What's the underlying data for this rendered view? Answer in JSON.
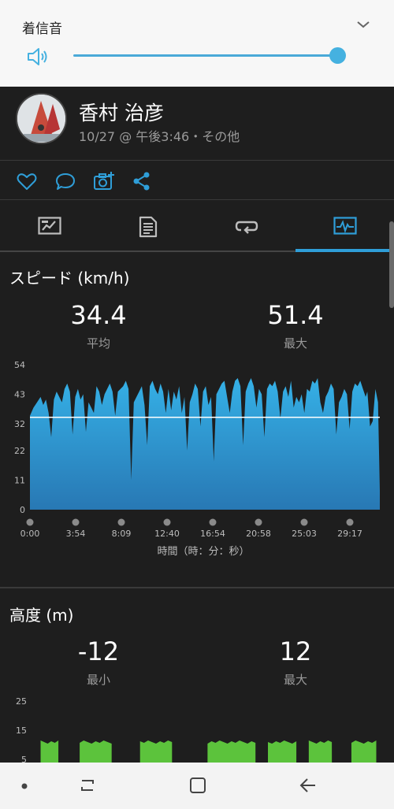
{
  "volume": {
    "label": "着信音",
    "level_percent": 100,
    "accent_color": "#45b1e0",
    "icons": [
      "speaker-icon",
      "chevron-down-icon"
    ]
  },
  "header": {
    "name": "香村 治彦",
    "meta": "10/27 @ 午後3:46・その他"
  },
  "social": {
    "icons": [
      "heart-icon",
      "comment-icon",
      "add-photo-icon",
      "share-icon"
    ],
    "color": "#2f9ed8"
  },
  "tabs": {
    "items": [
      "overview-tab-icon",
      "details-tab-icon",
      "laps-tab-icon",
      "charts-tab-icon"
    ],
    "active_index": 3
  },
  "speed": {
    "title": "スピード (km/h)",
    "avg_value": "34.4",
    "avg_label": "平均",
    "max_value": "51.4",
    "max_label": "最大"
  },
  "altitude": {
    "title": "高度 (m)",
    "min_value": "-12",
    "min_label": "最小",
    "max_value": "12",
    "max_label": "最大"
  },
  "chart_data": [
    {
      "type": "area",
      "xlabel": "時間（時：分：秒）",
      "ylabel": "",
      "x_tick_labels": [
        "0:00",
        "3:54",
        "8:09",
        "12:40",
        "16:54",
        "20:58",
        "25:03",
        "29:17"
      ],
      "y_ticks": [
        "0",
        "11",
        "22",
        "32",
        "43",
        "54"
      ],
      "ylim": [
        0,
        54
      ],
      "xlim": [
        0,
        1970
      ],
      "average_line": 34.4,
      "fill_color": "#2fa3d8",
      "x": [
        0,
        20,
        40,
        60,
        75,
        90,
        105,
        120,
        135,
        150,
        165,
        180,
        195,
        210,
        225,
        240,
        255,
        270,
        285,
        300,
        315,
        330,
        345,
        360,
        375,
        390,
        405,
        420,
        435,
        450,
        465,
        480,
        495,
        510,
        525,
        540,
        555,
        570,
        585,
        600,
        615,
        630,
        645,
        660,
        675,
        690,
        705,
        720,
        735,
        750,
        765,
        780,
        795,
        810,
        825,
        840,
        855,
        870,
        885,
        900,
        915,
        930,
        945,
        960,
        975,
        990,
        1005,
        1020,
        1035,
        1050,
        1065,
        1080,
        1095,
        1110,
        1125,
        1140,
        1155,
        1170,
        1185,
        1200,
        1215,
        1230,
        1245,
        1260,
        1275,
        1290,
        1305,
        1320,
        1335,
        1350,
        1365,
        1380,
        1395,
        1410,
        1425,
        1440,
        1455,
        1470,
        1485,
        1500,
        1515,
        1530,
        1545,
        1560,
        1575,
        1590,
        1605,
        1620,
        1635,
        1650,
        1665,
        1680,
        1695,
        1710,
        1725,
        1740,
        1755,
        1770,
        1785,
        1800,
        1815,
        1830,
        1845,
        1860,
        1875,
        1890,
        1900,
        1915,
        1930,
        1945,
        1960,
        1970
      ],
      "y": [
        35,
        38,
        40,
        42,
        39,
        41,
        36,
        27,
        41,
        44,
        42,
        40,
        45,
        47,
        44,
        28,
        42,
        45,
        41,
        43,
        29,
        40,
        38,
        36,
        46,
        44,
        39,
        43,
        45,
        47,
        44,
        35,
        44,
        45,
        46,
        48,
        45,
        11,
        40,
        42,
        44,
        46,
        39,
        24,
        46,
        48,
        45,
        43,
        47,
        44,
        36,
        45,
        37,
        44,
        41,
        46,
        36,
        42,
        22,
        40,
        43,
        47,
        45,
        31,
        44,
        46,
        39,
        42,
        18,
        43,
        45,
        47,
        48,
        42,
        36,
        44,
        48,
        49,
        46,
        24,
        44,
        47,
        49,
        46,
        38,
        45,
        43,
        27,
        45,
        47,
        46,
        48,
        44,
        34,
        44,
        46,
        42,
        48,
        38,
        42,
        40,
        43,
        36,
        45,
        44,
        48,
        47,
        49,
        40,
        36,
        42,
        44,
        47,
        45,
        28,
        40,
        42,
        45,
        43,
        30,
        44,
        47,
        46,
        48,
        45,
        42,
        44,
        31,
        33,
        45,
        40,
        7,
        4
      ]
    },
    {
      "type": "area",
      "xlabel": "",
      "ylabel": "",
      "y_ticks": [
        "5",
        "15",
        "25"
      ],
      "ylim": [
        0,
        25
      ],
      "fill_color": "#5cc33c",
      "segments": [
        [
          60,
          160
        ],
        [
          280,
          460
        ],
        [
          620,
          800
        ],
        [
          1000,
          1270
        ],
        [
          1340,
          1500
        ],
        [
          1570,
          1700
        ],
        [
          1810,
          1950
        ]
      ]
    }
  ],
  "navbar": {
    "icons": [
      "dot-icon",
      "recent-apps-icon",
      "home-icon",
      "back-icon"
    ]
  }
}
